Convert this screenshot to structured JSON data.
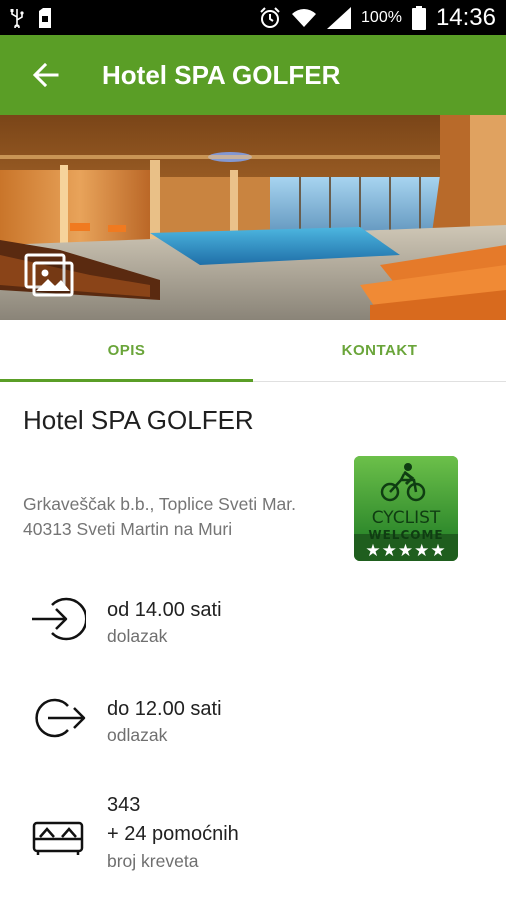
{
  "status_bar": {
    "battery_percent": "100%",
    "time": "14:36"
  },
  "app_bar": {
    "title": "Hotel SPA GOLFER"
  },
  "tabs": [
    {
      "label": "OPIS",
      "active": true
    },
    {
      "label": "KONTAKT",
      "active": false
    }
  ],
  "hotel": {
    "name": "Hotel SPA GOLFER",
    "address_line1": "Grkaveščak b.b., Toplice Sveti Mar.",
    "address_line2": "40313 Sveti Martin na Muri"
  },
  "badge": {
    "text_top": "CYCLIST",
    "text_bottom": "WELCOME",
    "stars": "★★★★★"
  },
  "checkin": {
    "value": "od 14.00 sati",
    "label": "dolazak",
    "icon": "login-icon"
  },
  "checkout": {
    "value": "do 12.00 sati",
    "label": "odlazak",
    "icon": "logout-icon"
  },
  "beds": {
    "value_line1": "343",
    "value_line2": "+ 24 pomoćnih",
    "label": "broj kreveta",
    "icon": "bed-icon"
  },
  "colors": {
    "primary": "#5a9e26",
    "tab_text": "#6aa53a"
  }
}
